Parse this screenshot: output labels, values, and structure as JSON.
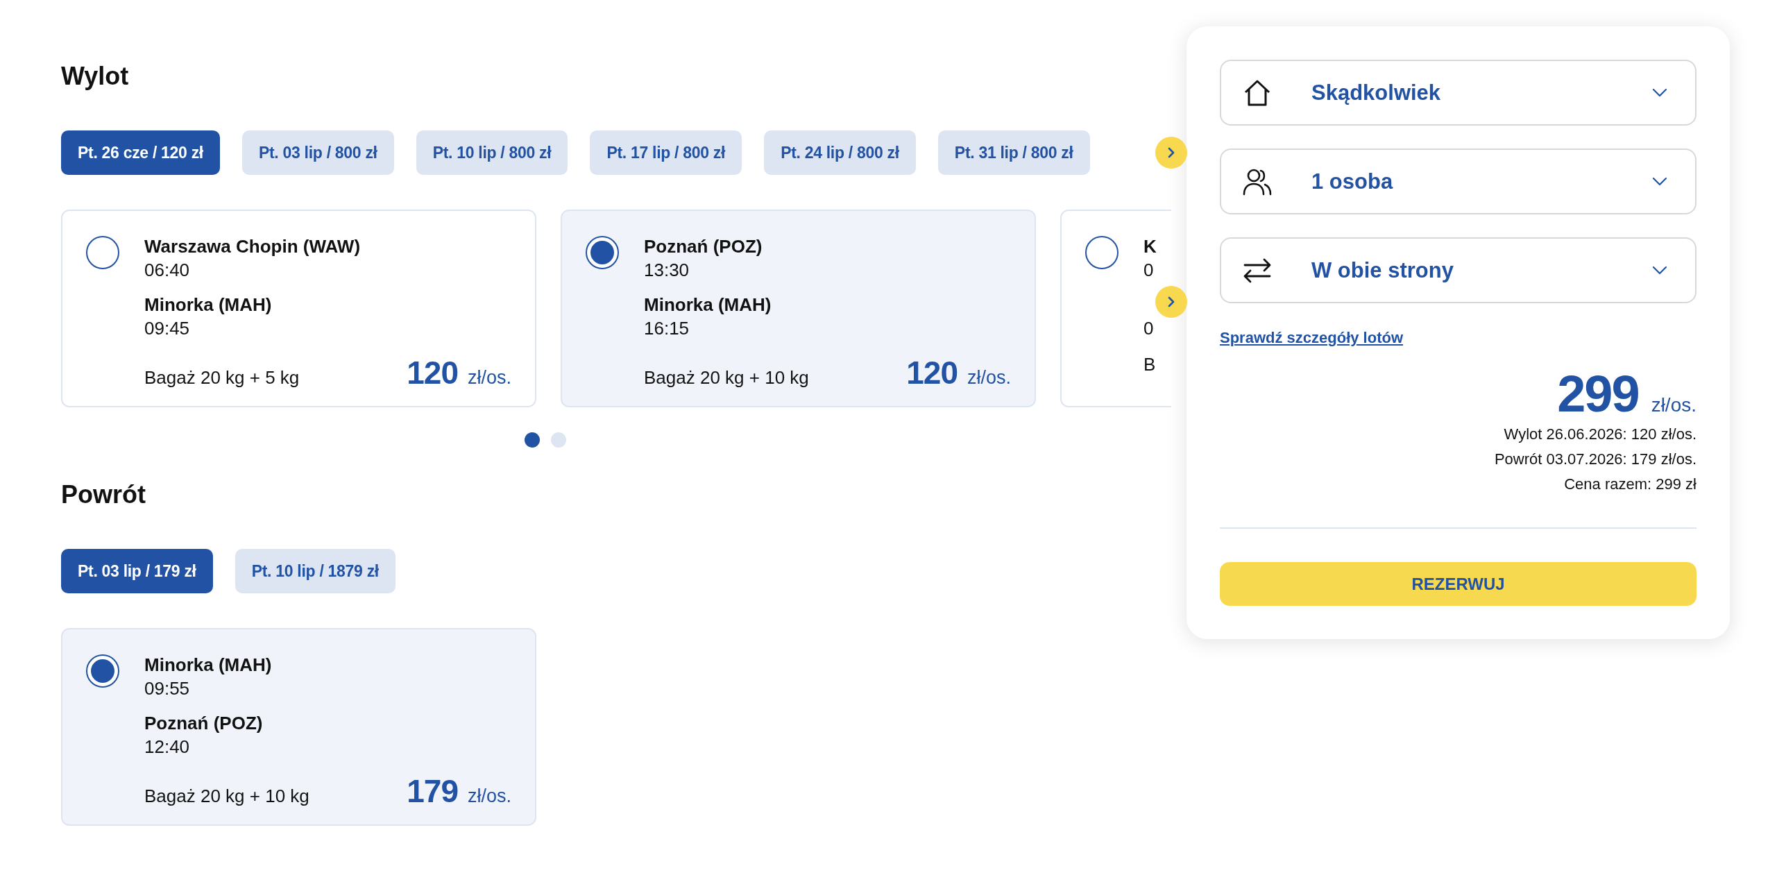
{
  "outbound": {
    "title": "Wylot",
    "date_tabs": [
      {
        "label": "Pt. 26 cze / 120 zł",
        "selected": true
      },
      {
        "label": "Pt. 03 lip / 800 zł",
        "selected": false
      },
      {
        "label": "Pt. 10 lip / 800 zł",
        "selected": false
      },
      {
        "label": "Pt. 17 lip / 800 zł",
        "selected": false
      },
      {
        "label": "Pt. 24 lip / 800 zł",
        "selected": false
      },
      {
        "label": "Pt. 31 lip / 800 zł",
        "selected": false
      }
    ],
    "flights": [
      {
        "selected": false,
        "origin": "Warszawa Chopin (WAW)",
        "departure": "06:40",
        "destination": "Minorka (MAH)",
        "arrival": "09:45",
        "baggage": "Bagaż 20 kg + 5 kg",
        "price": "120",
        "unit": "zł/os."
      },
      {
        "selected": true,
        "origin": "Poznań (POZ)",
        "departure": "13:30",
        "destination": "Minorka (MAH)",
        "arrival": "16:15",
        "baggage": "Bagaż 20 kg + 10 kg",
        "price": "120",
        "unit": "zł/os."
      },
      {
        "selected": false,
        "origin": "K",
        "departure": "0",
        "arrival": "0",
        "baggage": "B"
      }
    ],
    "pagination": [
      {
        "selected": true
      },
      {
        "selected": false
      }
    ]
  },
  "return": {
    "title": "Powrót",
    "date_tabs": [
      {
        "label": "Pt. 03 lip / 179 zł",
        "selected": true
      },
      {
        "label": "Pt. 10 lip / 1879 zł",
        "selected": false
      }
    ],
    "flights": [
      {
        "selected": true,
        "origin": "Minorka (MAH)",
        "departure": "09:55",
        "destination": "Poznań (POZ)",
        "arrival": "12:40",
        "baggage": "Bagaż 20 kg + 10 kg",
        "price": "179",
        "unit": "zł/os."
      }
    ]
  },
  "booking": {
    "fields": [
      {
        "kind": "home",
        "value": "Skądkolwiek"
      },
      {
        "kind": "people",
        "value": "1 osoba"
      },
      {
        "kind": "swap",
        "value": "W obie strony"
      }
    ],
    "details_link": "Sprawdź szczegóły lotów",
    "total_price": "299",
    "total_unit": "zł/os.",
    "breakdown": [
      "Wylot 26.06.2026: 120 zł/os.",
      "Powrót 03.07.2026: 179 zł/os.",
      "Cena razem: 299 zł"
    ],
    "book_button": "REZERWUJ"
  }
}
